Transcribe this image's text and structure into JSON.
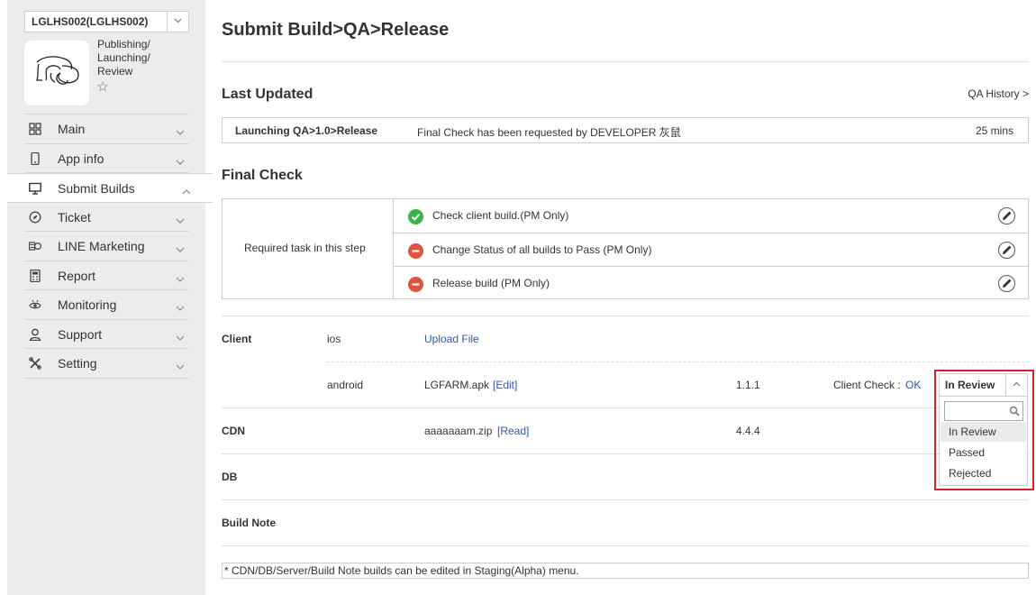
{
  "sidebar": {
    "project_select": "LGLHS002(LGLHS002)",
    "app_stage_lines": [
      "Publishing/",
      "Launching/",
      "Review"
    ],
    "nav": [
      {
        "label": "Main",
        "icon": "grid-icon"
      },
      {
        "label": "App info",
        "icon": "phone-icon"
      },
      {
        "label": "Submit Builds",
        "icon": "monitor-icon",
        "active": true
      },
      {
        "label": "Ticket",
        "icon": "compass-icon"
      },
      {
        "label": "LINE Marketing",
        "icon": "coins-icon"
      },
      {
        "label": "Report",
        "icon": "calculator-icon"
      },
      {
        "label": "Monitoring",
        "icon": "eye-icon"
      },
      {
        "label": "Support",
        "icon": "person-icon"
      },
      {
        "label": "Setting",
        "icon": "tools-icon"
      }
    ]
  },
  "main": {
    "title": "Submit Build>QA>Release",
    "last_updated": {
      "heading": "Last Updated",
      "history_link": "QA History >",
      "step": "Launching QA>1.0>Release",
      "message": "Final Check has been requested by DEVELOPER 灰鼠",
      "time": "25 mins"
    },
    "final_check": {
      "heading": "Final Check",
      "left_label": "Required task in this step",
      "tasks": [
        {
          "text": "Check client build.(PM Only)",
          "status": "done"
        },
        {
          "text": "Change Status of all builds to Pass (PM Only)",
          "status": "blocked"
        },
        {
          "text": "Release build (PM Only)",
          "status": "blocked"
        }
      ]
    },
    "builds": {
      "client_label": "Client",
      "ios": {
        "platform": "ios",
        "action": "Upload File"
      },
      "android": {
        "platform": "android",
        "file": "LGFARM.apk",
        "edit": "[Edit]",
        "version": "1.1.1",
        "check_label": "Client Check :",
        "check_value": "OK"
      },
      "cdn": {
        "label": "CDN",
        "file": "aaaaaaam.zip",
        "read": "[Read]",
        "version": "4.4.4"
      },
      "db_label": "DB",
      "build_note_label": "Build Note",
      "footnote": "* CDN/DB/Server/Build Note builds can be edited in Staging(Alpha) menu."
    },
    "status_dropdown": {
      "selected": "In Review",
      "options": [
        "In Review",
        "Passed",
        "Rejected"
      ],
      "highlight_color": "#d0232e"
    }
  }
}
